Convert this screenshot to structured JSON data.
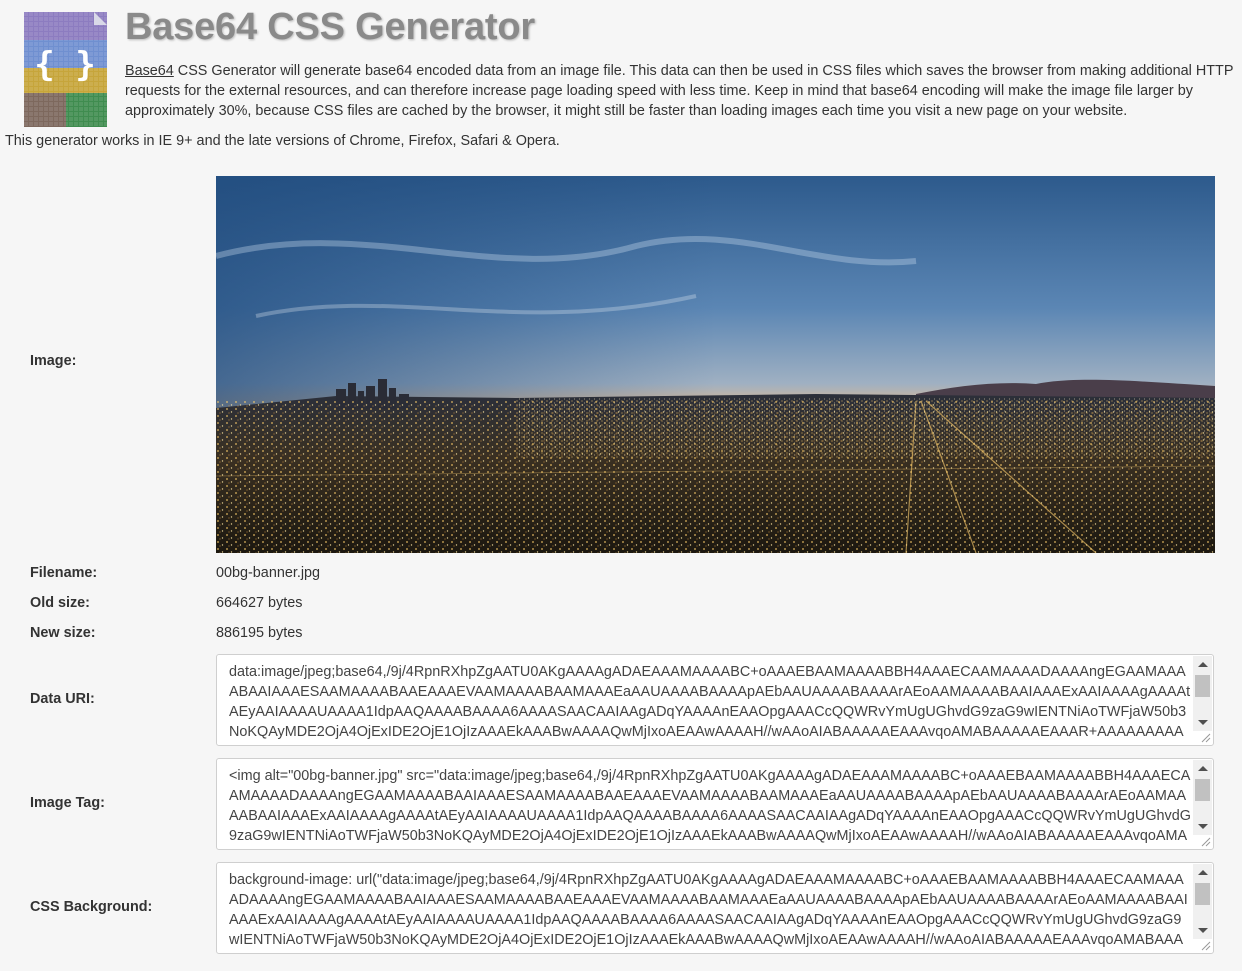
{
  "header": {
    "title": "Base64 CSS Generator",
    "intro_word": "Base64",
    "intro_rest": " CSS Generator will generate base64 encoded data from an image file. This data can then be used in CSS files which saves the browser from making additional HTTP requests for the external resources, and can therefore increase page loading speed with less time. Keep in mind that base64 encoding will make the image file larger by approximately 30%, because CSS files are cached by the browser, it might still be faster than loading images each time you visit a new page on your website.",
    "support": "This generator works in IE 9+ and the late versions of Chrome, Firefox, Safari & Opera."
  },
  "fields": {
    "image_label": "Image:",
    "filename_label": "Filename:",
    "filename": "00bg-banner.jpg",
    "old_size_label": "Old size:",
    "old_size": "664627 bytes",
    "new_size_label": "New size:",
    "new_size": "886195 bytes",
    "data_uri_label": "Data URI:",
    "data_uri": "data:image/jpeg;base64,/9j/4RpnRXhpZgAATU0AKgAAAAgADAEAAAMAAAABC+oAAAEBAAMAAAABBH4AAAECAAMAAAADAAAAngEGAAMAAAABAAIAAAESAAMAAAABAAEAAAEVAAMAAAABAAMAAAEaAAUAAAABAAAApAEbAAUAAAABAAAArAEoAAMAAAABAAIAAAExAAIAAAAgAAAAtAEyAAIAAAAUAAAA1IdpAAQAAAABAAAA6AAAASAACAAIAAgADqYAAAAnEAAOpgAAACcQQWRvYmUgUGhvdG9zaG9wIENTNiAoTWFjaW50b3NoKQAyMDE2OjA4OjExIDE2OjE1OjIzAAAEkAAABwAAAAQwMjIxoAEAAwAAAAH//wAAoAIABAAAAAEAAAvqoAMABAAAAAEAAAR+AAAAAAAAAAYBAwADAAAAAQAGAAABGgAFAAAAAQAAAW4BGwAFAAAAAQAAAXYBKAADAAAAAQACAAACAQAEAAAAAQAAAX4CAgAEAAAAAQAAGOEAAAAAAAAASAAAAAEAAABIAAAAAf",
    "image_tag_label": "Image Tag:",
    "image_tag": "<img alt=\"00bg-banner.jpg\" src=\"data:image/jpeg;base64,/9j/4RpnRXhpZgAATU0AKgAAAAgADAEAAAMAAAABC+oAAAEBAAMAAAABBH4AAAECAAMAAAADAAAAngEGAAMAAAABAAIAAAESAAMAAAABAAEAAAEVAAMAAAABAAMAAAEaAAUAAAABAAAApAEbAAUAAAABAAAArAEoAAMAAAABAAIAAAExAAIAAAAgAAAAtAEyAAIAAAAUAAAA1IdpAAQAAAABAAAA6AAAASAACAAIAAgADqYAAAAnEAAOpgAAACcQQWRvYmUgUGhvdG9zaG9wIENTNiAoTWFjaW50b3NoKQAyMDE2OjA4OjExIDE2OjE1OjIzAAAEkAAABwAAAAQwMjIxoAEAAwAAAAH//wAAoAIABAAAAAEAAAvqoAMABAAAAAEAAAR+AAAAAAAAAAYBAwADAAAAAQAGAAABGgAF",
    "css_bg_label": "CSS Background:",
    "css_bg": "background-image: url(\"data:image/jpeg;base64,/9j/4RpnRXhpZgAATU0AKgAAAAgADAEAAAMAAAABC+oAAAEBAAMAAAABBH4AAAECAAMAAAADAAAAngEGAAMAAAABAAIAAAESAAMAAAABAAEAAAEVAAMAAAABAAMAAAEaAAUAAAABAAAApAEbAAUAAAABAAAArAEoAAMAAAABAAIAAAExAAIAAAAgAAAAtAEyAAIAAAAUAAAA1IdpAAQAAAABAAAA6AAAASAACAAIAAgADqYAAAAnEAAOpgAAACcQQWRvYmUgUGhvdG9zaG9wIENTNiAoTWFjaW50b3NoKQAyMDE2OjA4OjExIDE2OjE1OjIzAAAEkAAABwAAAAQwMjIxoAEAAwAAAAH//wAAoAIABAAAAAEAAAvqoAMABAAAAAEAAAR+AAAAAAAAAAYBAwADAAAAAQAGAAABGgAF"
  },
  "icons": {
    "logo": "braces-logo-icon",
    "scroll_up": "scroll-up-arrow-icon",
    "scroll_down": "scroll-down-arrow-icon",
    "resize": "resize-grip-icon"
  }
}
